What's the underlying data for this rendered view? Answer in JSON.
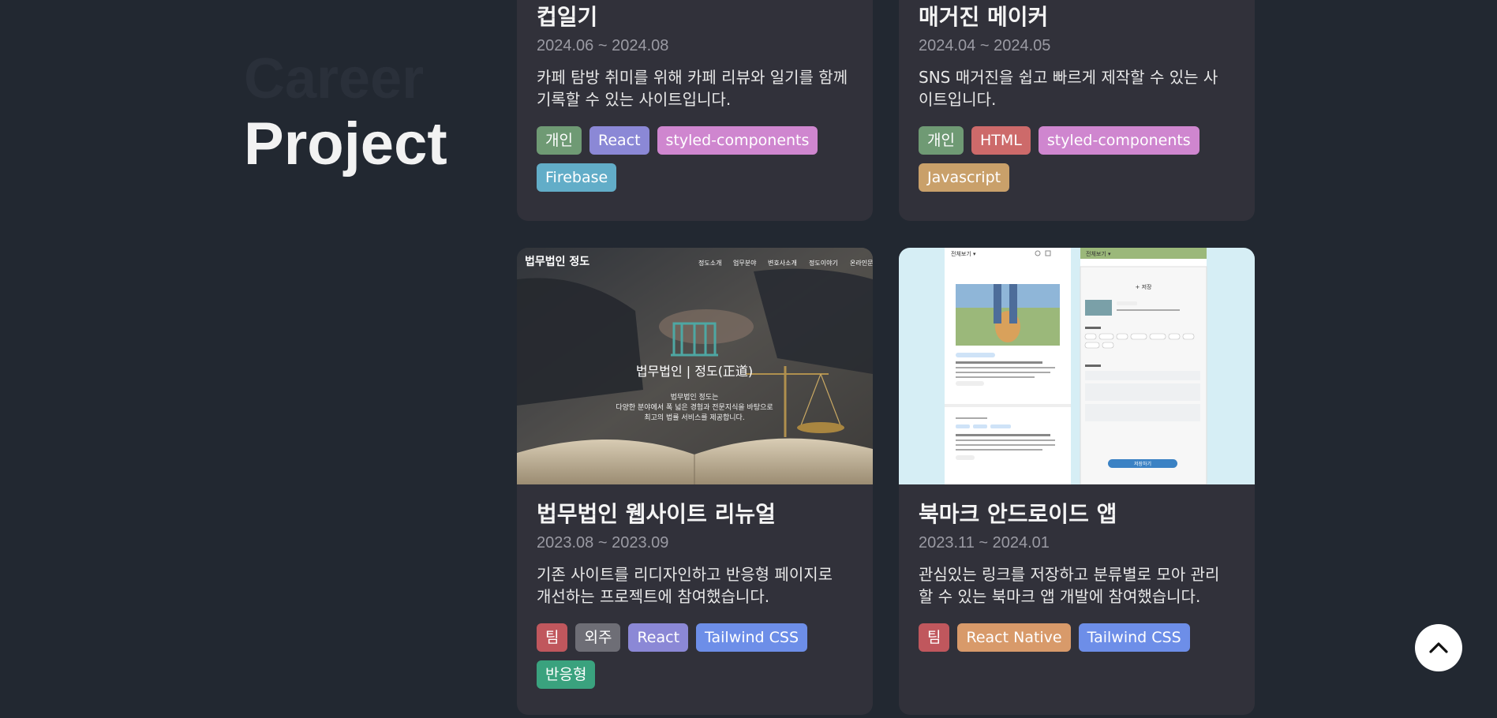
{
  "heading": {
    "faded": "Career",
    "main": "Project"
  },
  "colors": {
    "page_bg": "#222831",
    "card_bg": "#31313a",
    "tag_personal": "#6f9a74",
    "tag_team": "#c0575d",
    "tag_outsourced": "#6e6e76",
    "tag_react": "#8b88d6",
    "tag_styled": "#cf86cf",
    "tag_firebase": "#62adc8",
    "tag_html": "#cd6a6a",
    "tag_javascript": "#c9a06a",
    "tag_tailwind": "#6d8ee8",
    "tag_responsive": "#3aa27e",
    "tag_react_native": "#d89a6a"
  },
  "cards": [
    {
      "title": "컵일기",
      "date": "2024.06 ~ 2024.08",
      "desc_lines": [
        "카페 탐방 취미를 위해 카페 리뷰와 일기를 함께",
        "기록할 수 있는 사이트입니다."
      ],
      "tags": [
        "개인",
        "React",
        "styled-components",
        "Firebase"
      ]
    },
    {
      "title": "매거진 메이커",
      "date": "2024.04 ~ 2024.05",
      "desc_lines": [
        "SNS 매거진을 쉽고 빠르게 제작할 수 있는 사",
        "이트입니다."
      ],
      "tags": [
        "개인",
        "HTML",
        "styled-components",
        "Javascript"
      ]
    },
    {
      "title": "법무법인 웹사이트 리뉴얼",
      "date": "2023.08 ~ 2023.09",
      "desc_lines": [
        "기존 사이트를 리디자인하고 반응형 페이지로",
        "개선하는 프로젝트에 참여했습니다."
      ],
      "tags": [
        "팀",
        "외주",
        "React",
        "Tailwind CSS",
        "반응형"
      ],
      "thumbnail": {
        "logo": "법무법인 정도",
        "nav": [
          "정도소개",
          "업무분야",
          "변호사소개",
          "정도이야기",
          "온라인문"
        ],
        "hero_title": "법무법인 | 정도(正道)",
        "hero_lines": [
          "법무법인 정도는",
          "다양한 분야에서 폭 넓은 경험과 전문지식을 바탕으로",
          "최고의 법률 서비스를 제공합니다."
        ]
      }
    },
    {
      "title": "북마크 안드로이드 앱",
      "date": "2023.11 ~ 2024.01",
      "desc_lines": [
        "관심있는 링크를 저장하고 분류별로 모아 관리",
        "할 수 있는 북마크 앱 개발에 참여했습니다."
      ],
      "tags": [
        "팀",
        "React Native",
        "Tailwind CSS"
      ],
      "thumbnail": {
        "left_header": "전체보기 ▾",
        "right_header": "전체보기 ▾",
        "dialog_title": "+ 저장",
        "dialog_button": "저장하기"
      }
    }
  ],
  "icons": {
    "scroll_top": "chevron-up-icon"
  }
}
